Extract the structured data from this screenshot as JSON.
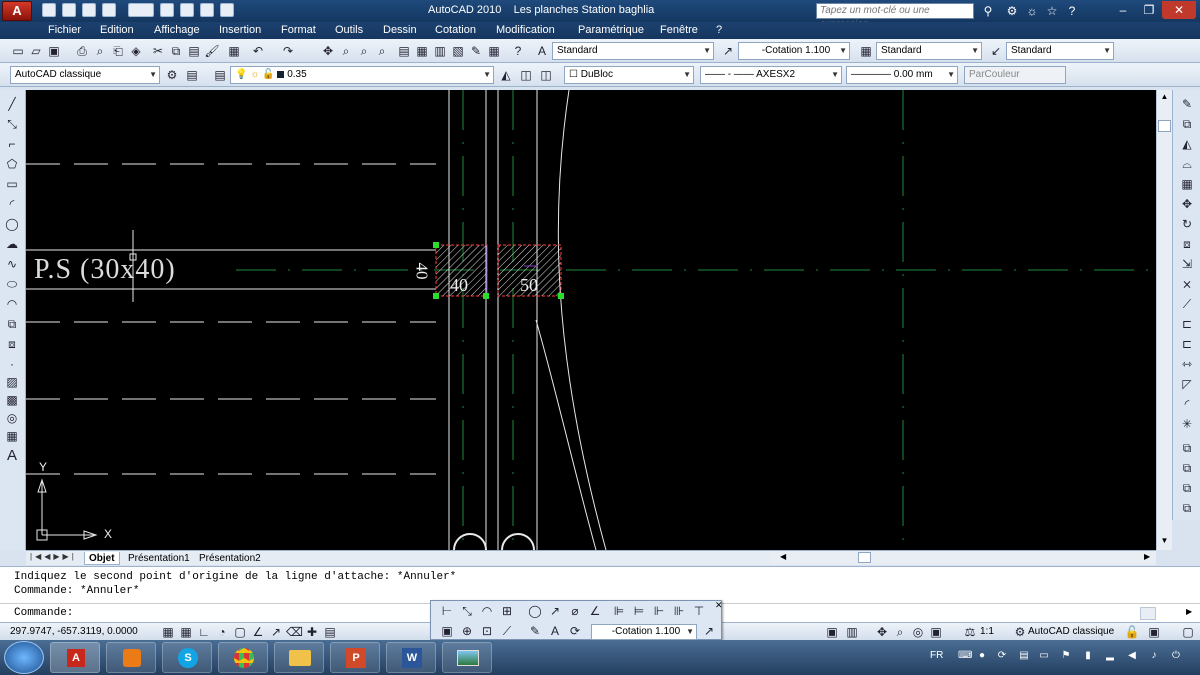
{
  "window": {
    "app_title": "AutoCAD 2010",
    "doc_title": "Les planches Station baghlia",
    "search_placeholder": "Tapez un mot-clé ou une expression",
    "logo_text": "A"
  },
  "menu": [
    "Fichier",
    "Edition",
    "Affichage",
    "Insertion",
    "Format",
    "Outils",
    "Dessin",
    "Cotation",
    "Modification",
    "Paramétrique",
    "Fenêtre",
    "?"
  ],
  "toolbar1": {
    "text_style": "Standard",
    "dim_style": "-Cotation 1.100",
    "table_style": "Standard",
    "mleader_style": "Standard"
  },
  "toolbar2": {
    "workspace": "AutoCAD classique",
    "layer": "0.35",
    "color": "DuBloc",
    "linetype": "AXESX2",
    "lineweight": "0.00 mm",
    "plotstyle": "ParCouleur"
  },
  "drawing": {
    "label": "P.S (30x40)",
    "dim_left": "40",
    "dim_right": "50",
    "dim_vertical": "40",
    "ucs_x": "X",
    "ucs_y": "Y"
  },
  "tabs": [
    "Objet",
    "Présentation1",
    "Présentation2"
  ],
  "command": {
    "line1": "Indiquez le second point d'origine de la ligne d'attache: *Annuler*",
    "line2": "Commande: *Annuler*",
    "prompt": "Commande:"
  },
  "floating_toolbar": {
    "dim_style": "-Cotation 1.100"
  },
  "status": {
    "coords": "297.9747, -657.3119, 0.0000",
    "scale": "1:1",
    "workspace": "AutoCAD classique"
  },
  "taskbar": {
    "lang": "FR",
    "apps": [
      "AutoCAD",
      "Media",
      "Skype",
      "Chrome",
      "Explorer",
      "PowerPoint",
      "Word",
      "Photos"
    ]
  },
  "colors": {
    "titlebar": "#1f4a7c",
    "canvas": "#000000",
    "hatch": "#ff3b3b",
    "axis_green": "#1e8a3a"
  }
}
